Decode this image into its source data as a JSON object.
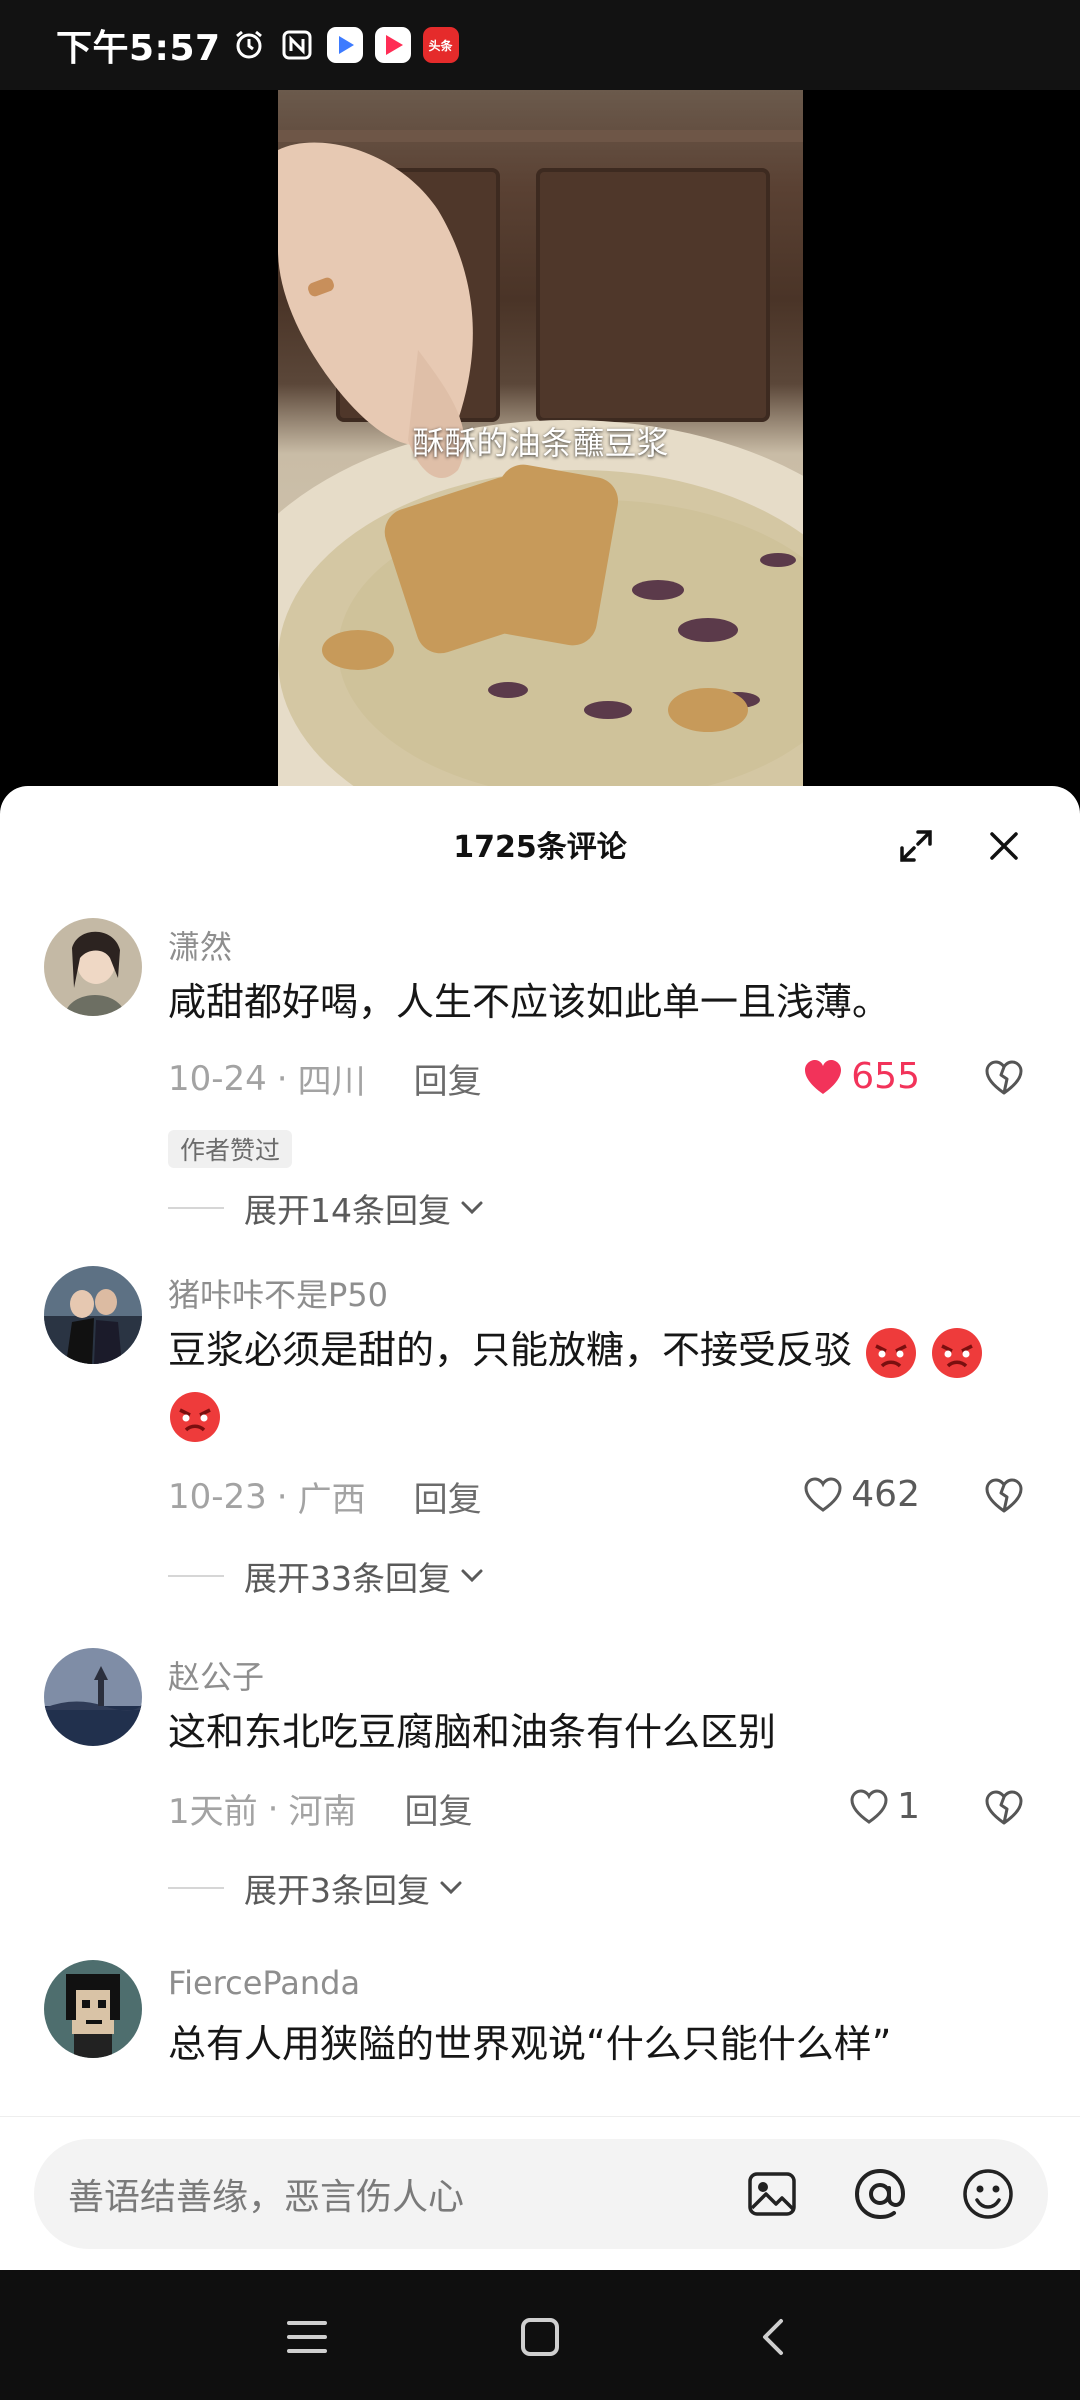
{
  "status_bar": {
    "time": "下午5:57",
    "icons": [
      "alarm-icon",
      "nfc-icon",
      "app-icon-blue",
      "app-icon-pink",
      "toutiao-icon"
    ],
    "toutiao_label": "头条"
  },
  "video": {
    "caption": "酥酥的油条蘸豆浆"
  },
  "comments_panel": {
    "title": "1725条评论",
    "comments": [
      {
        "author": "潇然",
        "text": "咸甜都好喝，人生不应该如此单一且浅薄。",
        "date": "10-24",
        "separator": "·",
        "location": "四川",
        "reply_label": "回复",
        "likes": "655",
        "liked": true,
        "badge": "作者赞过",
        "expand_label": "展开14条回复"
      },
      {
        "author": "猪咔咔不是P50",
        "text": "豆浆必须是甜的，只能放糖，不接受反驳",
        "date": "10-23",
        "separator": "·",
        "location": "广西",
        "reply_label": "回复",
        "likes": "462",
        "liked": false,
        "expand_label": "展开33条回复"
      },
      {
        "author": "赵公子",
        "text": "这和东北吃豆腐脑和油条有什么区别",
        "date": "1天前",
        "separator": "·",
        "location": "河南",
        "reply_label": "回复",
        "likes": "1",
        "liked": false,
        "expand_label": "展开3条回复"
      },
      {
        "author": "FiercePanda",
        "text": "总有人用狭隘的世界观说“什么只能什么样”"
      }
    ]
  },
  "input_bar": {
    "placeholder": "善语结善缘，恶言伤人心",
    "icons": [
      "image-icon",
      "at-icon",
      "emoji-icon"
    ]
  },
  "nav_bar": {
    "buttons": [
      "menu-icon",
      "home-icon",
      "back-icon"
    ]
  },
  "colors": {
    "like_active": "#f2335a",
    "text_primary": "#161616",
    "text_secondary": "#8e8e8e"
  }
}
